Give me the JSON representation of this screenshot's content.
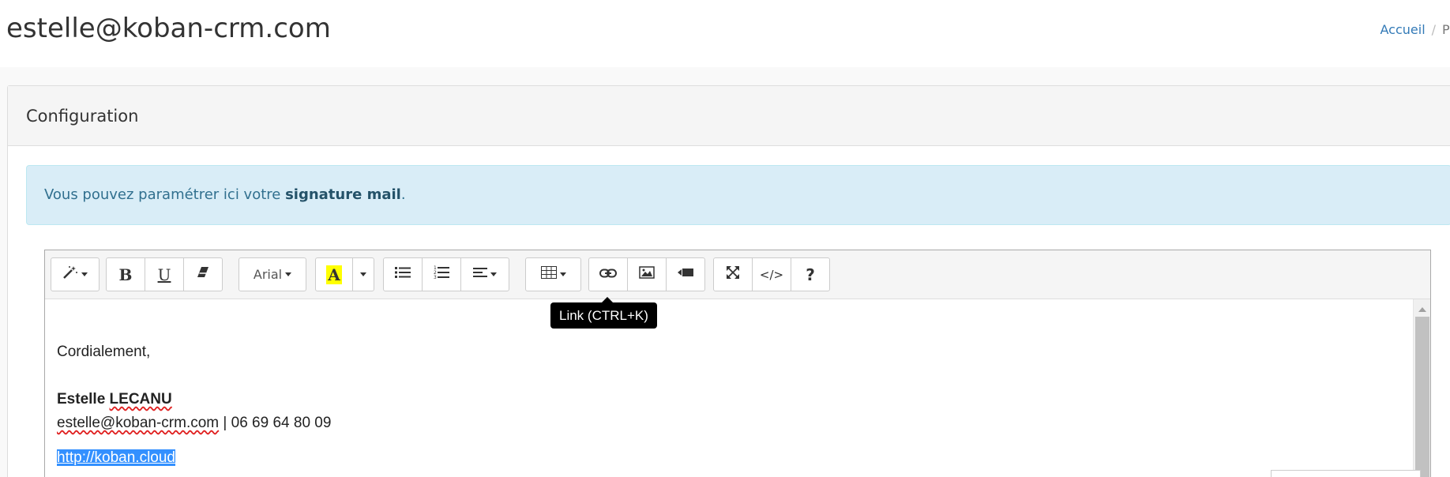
{
  "header": {
    "title": "estelle@koban-crm.com",
    "breadcrumb": {
      "home": "Accueil",
      "separator": "/",
      "next": "Pr"
    }
  },
  "panel": {
    "heading": "Configuration"
  },
  "alert": {
    "text_before": "Vous pouvez paramétrer ici votre ",
    "text_bold": "signature mail",
    "text_after": "."
  },
  "toolbar": {
    "font_name": "Arial",
    "bold_label": "B",
    "underline_label": "U",
    "color_label": "A",
    "code_label": "</>",
    "help_label": "?",
    "tooltip": "Link (CTRL+K)",
    "highlight_color": "#ffff00"
  },
  "signature": {
    "greeting": "Cordialement,",
    "first_name": "Estelle",
    "last_name": "LECANU",
    "email": "estelle@koban-crm.com",
    "separator": " | ",
    "phone": "06 69 64 80 09",
    "website": "http://koban.cloud"
  },
  "colors": {
    "alert_bg": "#d9edf7",
    "alert_text": "#31708f",
    "link": "#337ab7",
    "selection": "#3390ff"
  }
}
